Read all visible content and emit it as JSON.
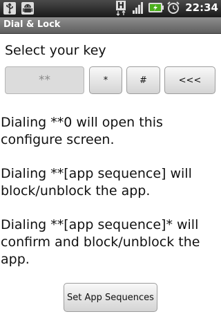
{
  "status_bar": {
    "left_icons": [
      "usb-icon",
      "android-debug-icon"
    ],
    "right_icons": [
      "hsdpa-icon",
      "signal-icon",
      "battery-charging-icon",
      "alarm-icon"
    ],
    "network_label": "H",
    "time": "22:34"
  },
  "title_bar": {
    "title": "Dial & Lock"
  },
  "main": {
    "select_label": "Select your key",
    "key_display": "**",
    "buttons": {
      "star": "*",
      "hash": "#",
      "backspace": "<<<"
    },
    "instructions": [
      "Dialing **0 will open this configure screen.",
      "Dialing **[app sequence] will block/unblock the app.",
      "Dialing **[app sequence]* will confirm and block/unblock the app."
    ],
    "set_button": "Set App Sequences"
  },
  "colors": {
    "status_bar": "#1a1a1a",
    "title_bar": "#6e6e6e",
    "battery_green": "#4caf1e"
  }
}
